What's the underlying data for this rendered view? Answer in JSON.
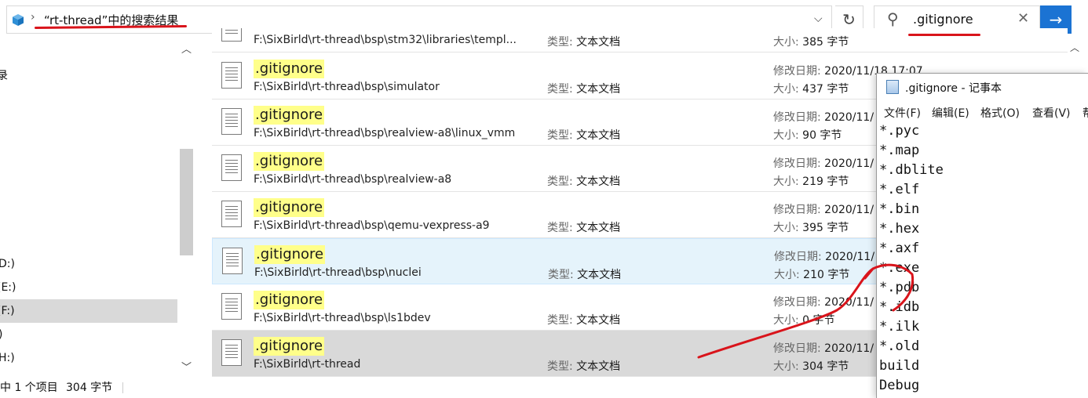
{
  "address_bar": {
    "breadcrumb_text": "“rt-thread”中的搜索结果",
    "chevron": "›",
    "dropdown": "⌵",
    "refresh": "↻"
  },
  "search": {
    "value": ".gitignore",
    "search_glyph": "⚲",
    "clear_glyph": "✕",
    "go_glyph": "→"
  },
  "nav": {
    "items": [
      {
        "label": "录"
      },
      {
        "label": "D:)"
      },
      {
        "label": "(E:)"
      },
      {
        "label": "(F:)"
      },
      {
        "label": ")"
      },
      {
        "label": "H:)"
      }
    ],
    "scroll_up": "︿",
    "scroll_down": "﹀"
  },
  "results": {
    "type_label": "类型:",
    "date_label": "修改日期:",
    "size_label": "大小:",
    "rows": [
      {
        "name": "",
        "path": "F:\\SixBirld\\rt-thread\\bsp\\stm32\\libraries\\templ...",
        "type": "文本文档",
        "date": "",
        "size": "385 字节"
      },
      {
        "name": ".gitignore",
        "path": "F:\\SixBirld\\rt-thread\\bsp\\simulator",
        "type": "文本文档",
        "date": "2020/11/18 17:07",
        "size": "437 字节"
      },
      {
        "name": ".gitignore",
        "path": "F:\\SixBirld\\rt-thread\\bsp\\realview-a8\\linux_vmm",
        "type": "文本文档",
        "date": "2020/11/",
        "size": "90 字节"
      },
      {
        "name": ".gitignore",
        "path": "F:\\SixBirld\\rt-thread\\bsp\\realview-a8",
        "type": "文本文档",
        "date": "2020/11/",
        "size": "219 字节"
      },
      {
        "name": ".gitignore",
        "path": "F:\\SixBirld\\rt-thread\\bsp\\qemu-vexpress-a9",
        "type": "文本文档",
        "date": "2020/11/",
        "size": "395 字节"
      },
      {
        "name": ".gitignore",
        "path": "F:\\SixBirld\\rt-thread\\bsp\\nuclei",
        "type": "文本文档",
        "date": "2020/11/",
        "size": "210 字节"
      },
      {
        "name": ".gitignore",
        "path": "F:\\SixBirld\\rt-thread\\bsp\\ls1bdev",
        "type": "文本文档",
        "date": "2020/11/",
        "size": "0 字节"
      },
      {
        "name": ".gitignore",
        "path": "F:\\SixBirld\\rt-thread",
        "type": "文本文档",
        "date": "2020/11/",
        "size": "304 字节"
      }
    ],
    "scroll_up": "︿"
  },
  "status": {
    "selected_text": "中 1 个项目",
    "size_text": "304 字节"
  },
  "notepad": {
    "title": ".gitignore - 记事本",
    "menu": [
      "文件(F)",
      "编辑(E)",
      "格式(O)",
      "查看(V)",
      "帮"
    ],
    "lines": [
      "*.pyc",
      "*.map",
      "*.dblite",
      "*.elf",
      "*.bin",
      "*.hex",
      "*.axf",
      "*.exe",
      "*.pdb",
      "*.idb",
      "*.ilk",
      "*.old",
      "build",
      "Debug"
    ]
  },
  "colors": {
    "accent": "#1b73d3",
    "highlight": "#ffff8a",
    "annotation_red": "#d9141b",
    "selection": "#d9d9d9",
    "hover": "#e5f3fb"
  }
}
